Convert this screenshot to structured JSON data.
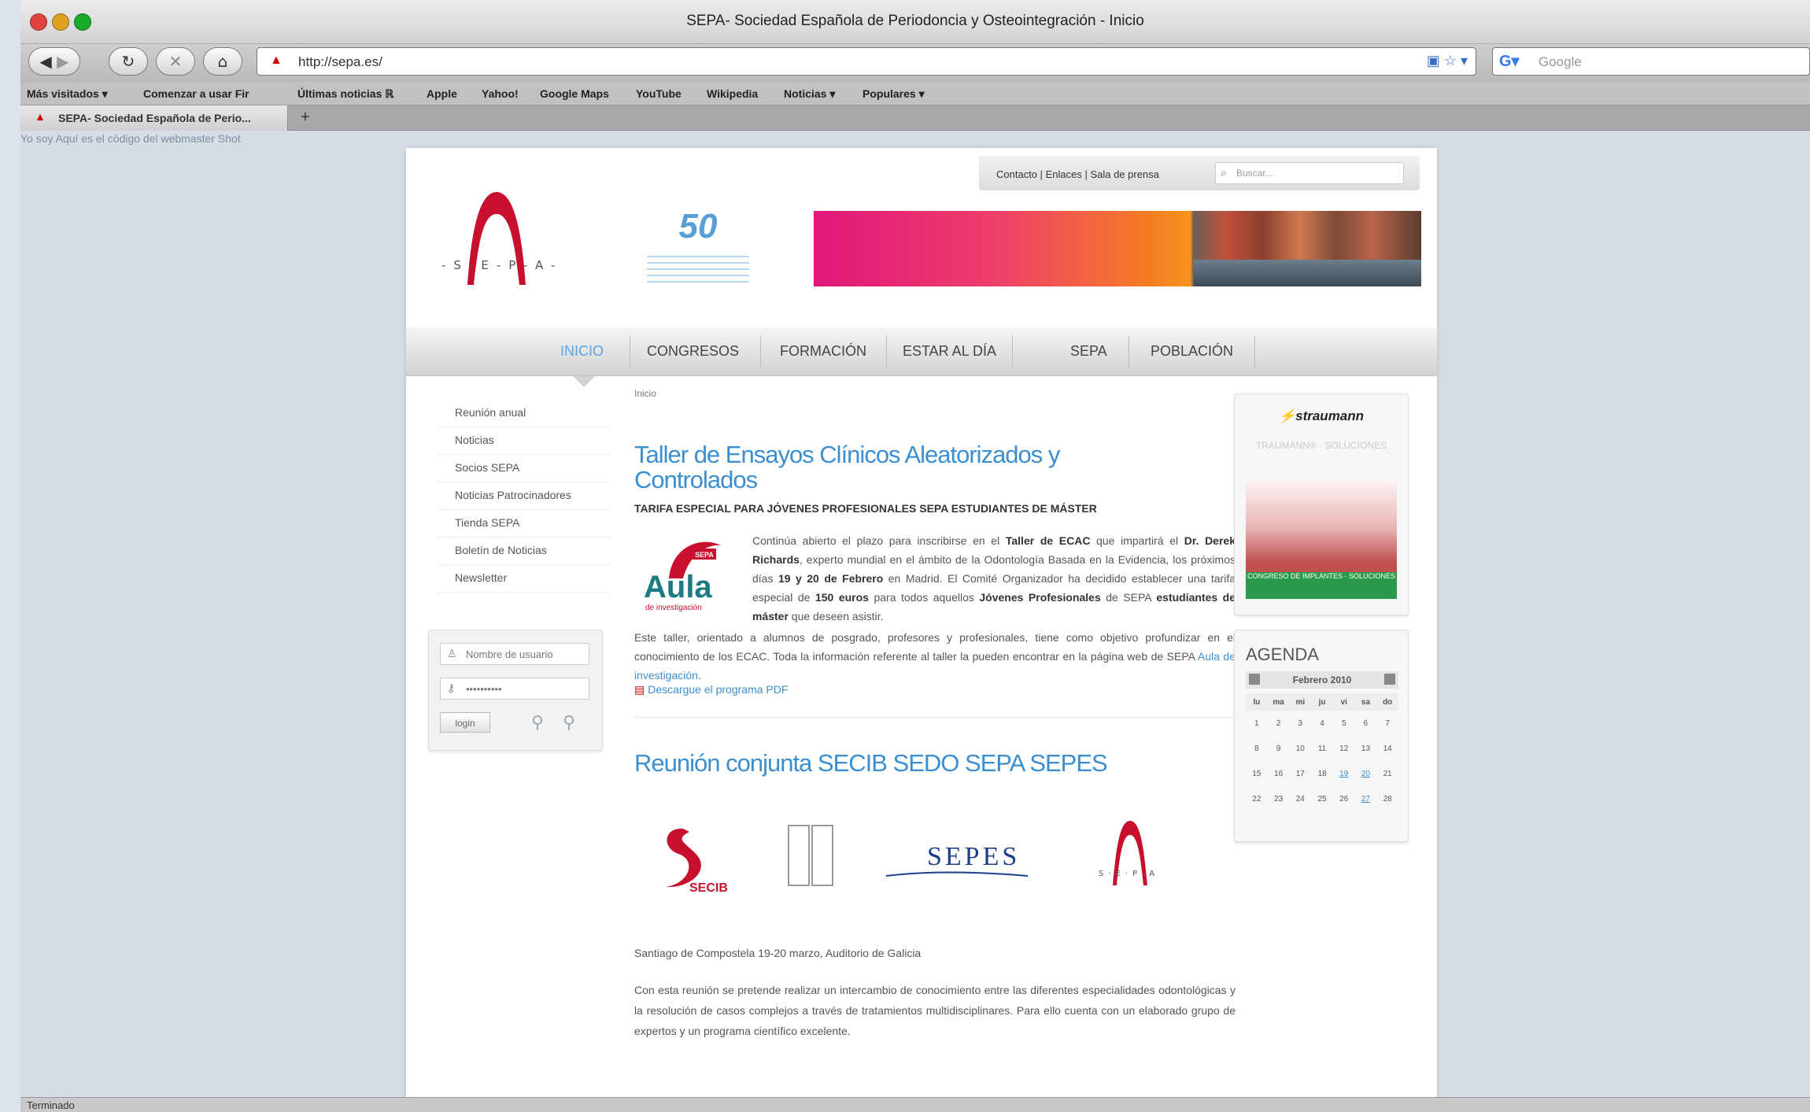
{
  "window": {
    "title": "SEPA- Sociedad Española de Periodoncia y Osteointegración - Inicio",
    "url": "http://sepa.es/",
    "google_placeholder": "Google",
    "status": "Terminado"
  },
  "bookmarks": [
    "Más visitados ▾",
    "Comenzar a usar Fir",
    "Últimas noticias ℝ",
    "Apple",
    "Yahoo!",
    "Google Maps",
    "YouTube",
    "Wikipedia",
    "Noticias ▾",
    "Populares ▾"
  ],
  "tab": {
    "title": "SEPA- Sociedad Española de Perio..."
  },
  "dev_note": "Yo soy Aquí es el código del webmaster Shot",
  "site": {
    "toplinks": "Contacto  |  Enlaces  |  Sala de prensa",
    "search_placeholder": "Buscar...",
    "nav": [
      "INICIO",
      "CONGRESOS",
      "FORMACIÓN",
      "ESTAR AL DÍA",
      "SEPA",
      "POBLACIÓN"
    ],
    "left_menu": [
      "Reunión anual",
      "Noticias",
      "Socios SEPA",
      "Noticias Patrocinadores",
      "Tienda SEPA",
      "Boletín de Noticias",
      "Newsletter"
    ],
    "login": {
      "user_placeholder": "Nombre de usuario",
      "password_value": "••••••••••",
      "button": "login"
    },
    "crumb": "Inicio",
    "article1": {
      "title_line1": "Taller de Ensayos Clínicos Aleatorizados y",
      "title_line2": "Controlados",
      "subhead": "TARIFA ESPECIAL PARA JÓVENES PROFESIONALES SEPA ESTUDIANTES DE MÁSTER",
      "intro_a": "Continúa abierto el plazo para inscribirse en el ",
      "intro_b": "Taller de ECAC",
      "intro_c": " que impartirá el ",
      "intro_d": "Dr. Derek Richards",
      "intro_e": ", experto mundial en el ámbito de la Odontología Basada en la Evidencia, los próximos días ",
      "intro_f": "19 y 20 de Febrero",
      "intro_g": " en Madrid. El Comité Organizador ha decidido establecer una tarifa especial de ",
      "intro_h": "150 euros",
      "intro_i": " para todos aquellos ",
      "intro_j": "Jóvenes Profesionales",
      "intro_k": " de SEPA ",
      "intro_l": "estudiantes de máster",
      "intro_m": " que deseen asistir.",
      "body": "Este taller, orientado a alumnos de posgrado, profesores y profesionales, tiene como objetivo profundizar en el conocimiento de los ECAC. Toda la información referente al taller la pueden encontrar en la página web de SEPA ",
      "body_link": "Aula de investigación",
      "pdf": "Descargue el programa PDF",
      "aula_label": "Aula",
      "aula_sub": "de investigación",
      "aula_badge": "SEPA"
    },
    "article2": {
      "title": "Reunión conjunta SECIB SEDO SEPA SEPES",
      "venue": "Santiago de Compostela 19-20 marzo, Auditorio de Galicia",
      "para": "Con esta reunión se pretende realizar un intercambio de conocimiento entre las diferentes especialidades odontológicas y la resolución de casos complejos a través de tratamientos multidisciplinares. Para ello cuenta con un elaborado grupo de expertos y un programa científico excelente.",
      "logo_secib": "SECIB",
      "logo_sepes": "SEPES"
    },
    "ad": {
      "brand": "straumann",
      "tag": "TRAUMANN® · SOLUCIONES",
      "caption": "CONGRESO DE IMPLANTES · SOLUCIONES"
    },
    "agenda": {
      "title": "AGENDA",
      "month": "Febrero 2010",
      "days": [
        "lu",
        "ma",
        "mi",
        "ju",
        "vi",
        "sa",
        "do"
      ],
      "weeks": [
        [
          "1",
          "2",
          "3",
          "4",
          "5",
          "6",
          "7"
        ],
        [
          "8",
          "9",
          "10",
          "11",
          "12",
          "13",
          "14"
        ],
        [
          "15",
          "16",
          "17",
          "18",
          "19",
          "20",
          "21"
        ],
        [
          "22",
          "23",
          "24",
          "25",
          "26",
          "27",
          "28"
        ]
      ]
    },
    "anniversary": "50"
  },
  "colors": {
    "accent": "#3b8fd1",
    "logo_red": "#c8102e",
    "bg": "#d6dde5"
  }
}
